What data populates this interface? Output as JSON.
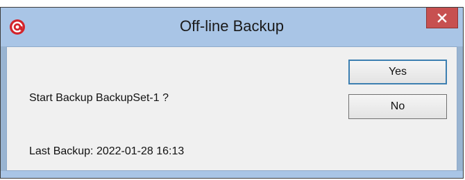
{
  "window": {
    "title": "Off-line Backup",
    "app_icon": "ahsay-logo-icon",
    "close_icon": "close-icon",
    "title_color": "#a9c5e6",
    "close_color": "#c75050"
  },
  "dialog": {
    "message": "Start Backup BackupSet-1 ?",
    "last_backup": "Last Backup: 2022-01-28 16:13",
    "yes_label": "Yes",
    "no_label": "No"
  }
}
